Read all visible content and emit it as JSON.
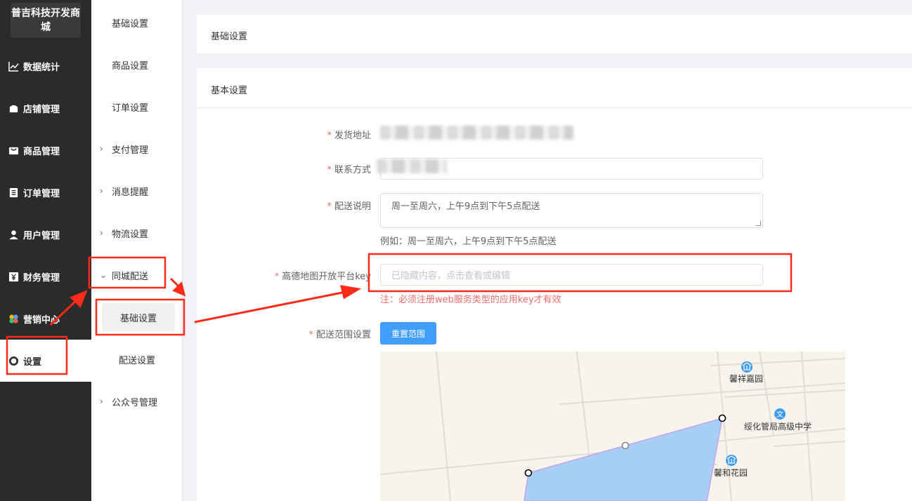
{
  "app": {
    "logo": "普吉科技开发商城"
  },
  "sidebar": {
    "items": [
      {
        "label": "数据统计",
        "icon": "line-chart-icon"
      },
      {
        "label": "店铺管理",
        "icon": "shop-icon"
      },
      {
        "label": "商品管理",
        "icon": "bag-icon"
      },
      {
        "label": "订单管理",
        "icon": "order-icon"
      },
      {
        "label": "用户管理",
        "icon": "user-icon"
      },
      {
        "label": "财务管理",
        "icon": "yen-icon"
      },
      {
        "label": "营销中心",
        "icon": "marketing-icon"
      },
      {
        "label": "设置",
        "icon": "gear-icon",
        "active": true
      }
    ]
  },
  "submenu": {
    "items": [
      {
        "label": "基础设置"
      },
      {
        "label": "商品设置"
      },
      {
        "label": "订单设置"
      },
      {
        "label": "支付管理",
        "expandable": true
      },
      {
        "label": "消息提醒",
        "expandable": true
      },
      {
        "label": "物流设置",
        "expandable": true
      },
      {
        "label": "同城配送",
        "expandable": true,
        "expanded": true
      },
      {
        "label": "基础设置",
        "child": true,
        "active": true
      },
      {
        "label": "配送设置",
        "child": true
      },
      {
        "label": "公众号管理",
        "expandable": true
      }
    ]
  },
  "main": {
    "breadcrumb_title": "基础设置",
    "section_title": "基本设置",
    "form": {
      "ship_address_label": "发货地址",
      "contact_label": "联系方式",
      "desc_label": "配送说明",
      "desc_value": "周一至周六，上午9点到下午5点配送",
      "desc_hint": "例如：周一至周六，上午9点到下午5点配送",
      "key_label": "高德地图开放平台key",
      "key_placeholder": "已隐藏内容，点击查看或编辑",
      "key_warning": "注：必须注册web服务类型的应用key才有效",
      "range_label": "配送范围设置",
      "reset_button": "重置范围"
    },
    "map": {
      "poi": [
        {
          "name": "馨祥嘉园",
          "icon": "building-icon"
        },
        {
          "name": "绥化管局高级中学",
          "icon": "school-icon"
        },
        {
          "name": "馨和花园",
          "icon": "building-icon"
        }
      ],
      "area_color": "#a6cff3",
      "area_border": "#c9a0f0"
    }
  },
  "colors": {
    "sidebar_bg": "#2b2b2b",
    "primary": "#409eff",
    "required": "#f56c6c",
    "annotation": "#ff2a1a"
  }
}
